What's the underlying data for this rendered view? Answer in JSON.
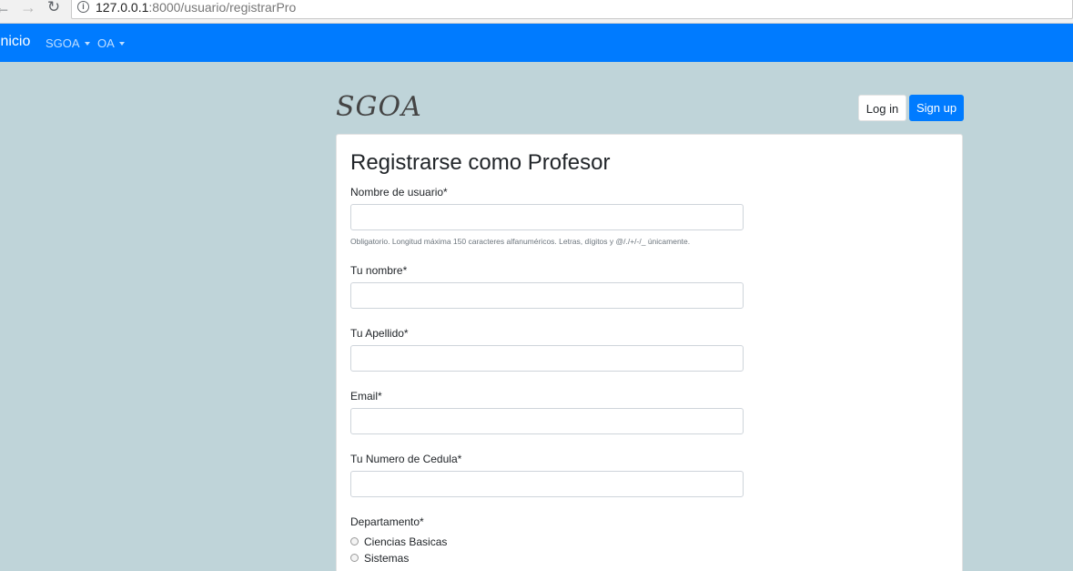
{
  "browser": {
    "url_host": "127.0.0.1",
    "url_rest": ":8000/usuario/registrarPro"
  },
  "navbar": {
    "brand": "Inicio",
    "items": [
      {
        "label": "SGOA"
      },
      {
        "label": "OA"
      }
    ]
  },
  "header": {
    "logo": "SGOA",
    "login_label": "Log in",
    "signup_label": "Sign up"
  },
  "form": {
    "title": "Registrarse como Profesor",
    "username": {
      "label": "Nombre de usuario*",
      "value": "",
      "help": "Obligatorio. Longitud máxima 150 caracteres alfanuméricos. Letras, dígitos y @/./+/-/_ únicamente."
    },
    "first_name": {
      "label": "Tu nombre*",
      "value": ""
    },
    "last_name": {
      "label": "Tu Apellido*",
      "value": ""
    },
    "email": {
      "label": "Email*",
      "value": ""
    },
    "cedula": {
      "label": "Tu Numero de Cedula*",
      "value": ""
    },
    "department": {
      "label": "Departamento*",
      "options": [
        "Ciencias Basicas",
        "Sistemas"
      ]
    }
  },
  "colors": {
    "navbar": "#007bff",
    "background": "#bfd4d9",
    "primary_button": "#007bff"
  }
}
